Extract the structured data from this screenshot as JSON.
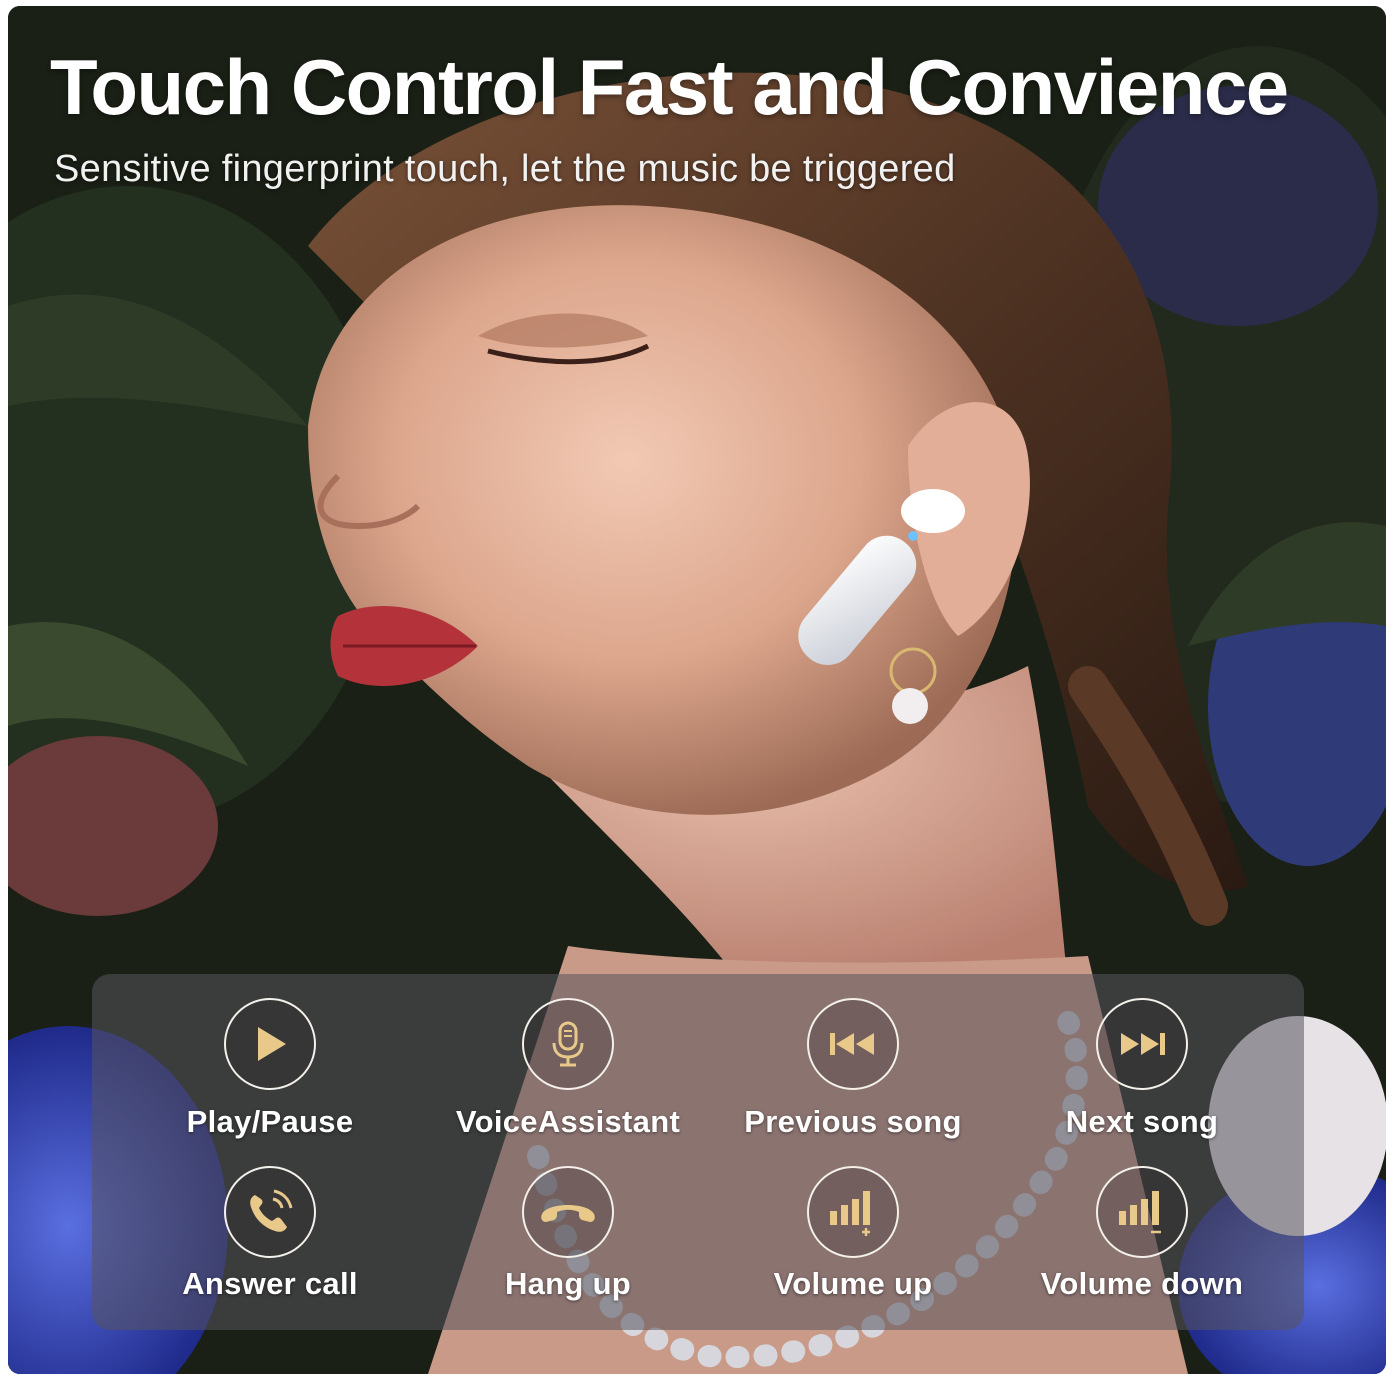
{
  "headline": "Touch Control Fast and Convience",
  "subheadline": "Sensitive fingerprint touch, let the music be triggered",
  "accent_color": "#e8c98a",
  "controls": [
    {
      "label": "Play/Pause",
      "icon": "play-icon"
    },
    {
      "label": "VoiceAssistant",
      "icon": "microphone-icon"
    },
    {
      "label": "Previous song",
      "icon": "previous-track-icon"
    },
    {
      "label": "Next song",
      "icon": "next-track-icon"
    },
    {
      "label": "Answer call",
      "icon": "phone-ringing-icon"
    },
    {
      "label": "Hang up",
      "icon": "hang-up-icon"
    },
    {
      "label": "Volume up",
      "icon": "volume-up-icon"
    },
    {
      "label": "Volume down",
      "icon": "volume-down-icon"
    }
  ]
}
